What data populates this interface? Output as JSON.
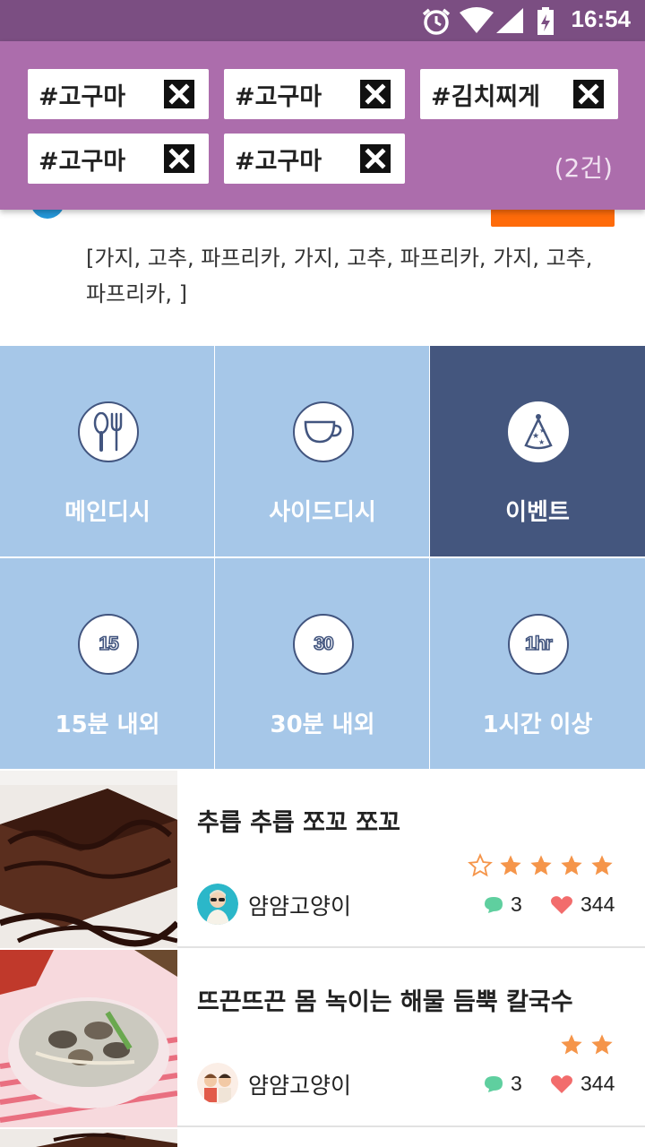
{
  "status_bar": {
    "time": "16:54"
  },
  "tags": [
    {
      "label": "#고구마"
    },
    {
      "label": "#고구마"
    },
    {
      "label": "#김치찌게"
    },
    {
      "label": "#고구마"
    },
    {
      "label": "#고구마"
    }
  ],
  "tag_count": "(2건)",
  "partial_card": {
    "ingredients": "[가지, 고추, 파프리카, 가지, 고추, 파프리카, 가지, 고추, 파프리카,  ]"
  },
  "categories": [
    {
      "label": "메인디시",
      "icon": "utensils-icon",
      "active": false
    },
    {
      "label": "사이드디시",
      "icon": "cup-icon",
      "active": false
    },
    {
      "label": "이벤트",
      "icon": "party-hat-icon",
      "active": true
    },
    {
      "label": "15분 내외",
      "icon": "clock-15-icon",
      "badge": "15",
      "active": false
    },
    {
      "label": "30분 내외",
      "icon": "clock-30-icon",
      "badge": "30",
      "active": false
    },
    {
      "label": "1시간 이상",
      "icon": "clock-1hr-icon",
      "badge": "1hr",
      "active": false
    }
  ],
  "recipes": [
    {
      "title": "추릅 추릅 쪼꼬 쪼꼬",
      "author": "얌얌고양이",
      "comments": "3",
      "likes": "344",
      "rating": 4,
      "stars_shown": 5
    },
    {
      "title": "뜨끈뜨끈 몸 녹이는 해물  듬뿍 칼국수",
      "author": "얌얌고양이",
      "comments": "3",
      "likes": "344",
      "rating": 2,
      "stars_shown": 2
    }
  ],
  "colors": {
    "status_bar": "#7b4e82",
    "header": "#ac6dac",
    "tile": "#a6c7e8",
    "tile_active": "#44567e",
    "star": "#f5954a",
    "comment": "#5fcf9f",
    "heart": "#f26c6c"
  }
}
